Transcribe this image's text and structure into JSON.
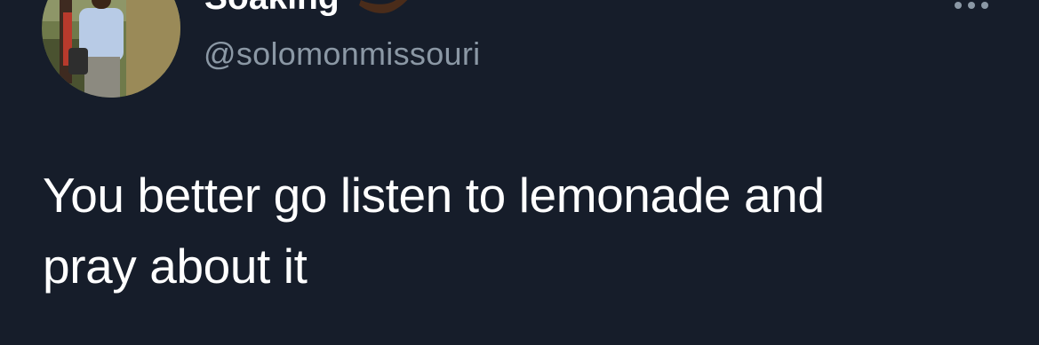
{
  "author": {
    "display_name": "Soaking",
    "name_emoji": "flexed-biceps-dark-skin-emoji",
    "handle": "@solomonmissouri",
    "avatar": "profile-photo"
  },
  "more_icon": "ellipsis-icon",
  "tweet": {
    "line1": "You better go listen to lemonade and",
    "line2": "pray about it"
  },
  "colors": {
    "background": "#161d2a",
    "text": "#ffffff",
    "secondary_text": "#8b98a5"
  }
}
